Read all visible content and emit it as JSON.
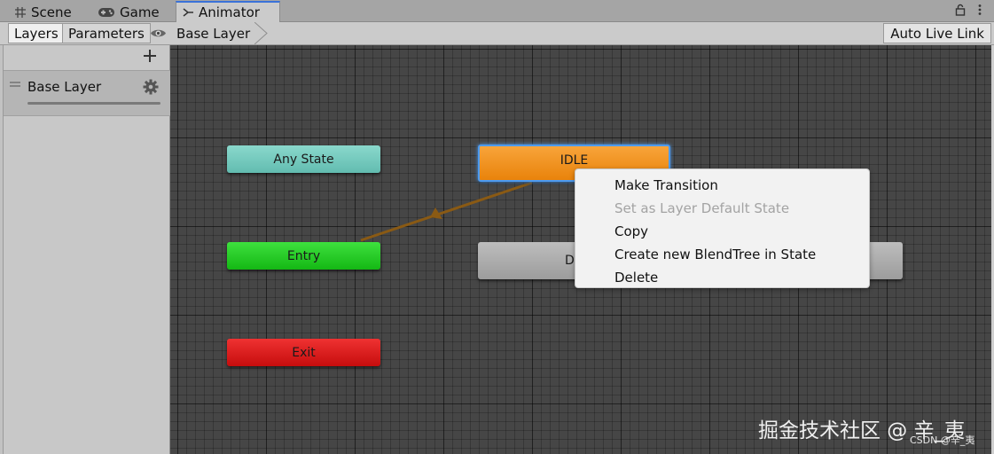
{
  "tabs": [
    {
      "label": "Scene",
      "icon": "grid-icon"
    },
    {
      "label": "Game",
      "icon": "gamepad-icon"
    },
    {
      "label": "Animator",
      "icon": "animator-icon",
      "active": true
    }
  ],
  "toolbar": {
    "layers_label": "Layers",
    "parameters_label": "Parameters",
    "breadcrumb": "Base Layer",
    "auto_live_link": "Auto Live Link"
  },
  "layers": [
    {
      "name": "Base Layer",
      "weight": 1.0
    }
  ],
  "states": {
    "any_state": "Any State",
    "entry": "Entry",
    "exit": "Exit",
    "idle": "IDLE",
    "second_state_partial": "D"
  },
  "context_menu": [
    {
      "label": "Make Transition",
      "enabled": true
    },
    {
      "label": "Set as Layer Default State",
      "enabled": false
    },
    {
      "label": "Copy",
      "enabled": true
    },
    {
      "label": "Create new BlendTree in State",
      "enabled": true
    },
    {
      "label": "Delete",
      "enabled": true
    }
  ],
  "watermark": {
    "main": "掘金技术社区 @ 辛_夷",
    "small": "CSDN @辛_夷"
  },
  "colors": {
    "any_state": "#6fc8bc",
    "entry": "#22c422",
    "exit": "#d81a1a",
    "idle": "#f0901c",
    "selection": "#4d9bf0",
    "transition": "#8a5a14"
  }
}
